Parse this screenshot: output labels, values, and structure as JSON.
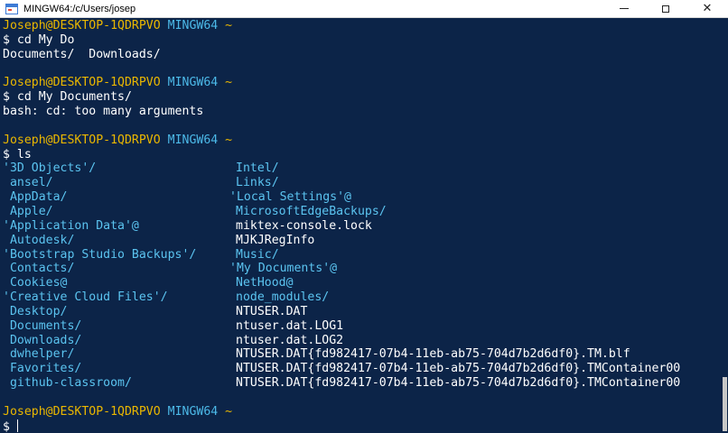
{
  "window": {
    "title": "MINGW64:/c/Users/josep",
    "close_glyph": "✕"
  },
  "prompt": {
    "user_host": "Joseph@DESKTOP-1QDRPVO",
    "system": "MINGW64",
    "path": "~",
    "symbol": "$"
  },
  "commands": [
    {
      "command": "cd My Do",
      "output": [
        "Documents/  Downloads/"
      ]
    },
    {
      "command": "cd My Documents/",
      "output": [
        "bash: cd: too many arguments"
      ]
    },
    {
      "command": "ls"
    }
  ],
  "ls_listing": {
    "rows": [
      {
        "left": "'3D Objects'/",
        "left_kind": "dir",
        "right": "Intel/",
        "right_kind": "dir"
      },
      {
        "left": " ansel/",
        "left_kind": "dir",
        "right": "Links/",
        "right_kind": "dir"
      },
      {
        "left": " AppData/",
        "left_kind": "dir",
        "right": "'Local Settings'@",
        "right_kind": "dir",
        "right_shift": true
      },
      {
        "left": " Apple/",
        "left_kind": "dir",
        "right": "MicrosoftEdgeBackups/",
        "right_kind": "dir"
      },
      {
        "left": "'Application Data'@",
        "left_kind": "dir",
        "right": "miktex-console.lock",
        "right_kind": "file"
      },
      {
        "left": " Autodesk/",
        "left_kind": "dir",
        "right": "MJKJRegInfo",
        "right_kind": "file"
      },
      {
        "left": "'Bootstrap Studio Backups'/",
        "left_kind": "dir",
        "right": "Music/",
        "right_kind": "dir"
      },
      {
        "left": " Contacts/",
        "left_kind": "dir",
        "right": "'My Documents'@",
        "right_kind": "dir",
        "right_shift": true
      },
      {
        "left": " Cookies@",
        "left_kind": "dir",
        "right": "NetHood@",
        "right_kind": "dir"
      },
      {
        "left": "'Creative Cloud Files'/",
        "left_kind": "dir",
        "right": "node_modules/",
        "right_kind": "dir"
      },
      {
        "left": " Desktop/",
        "left_kind": "dir",
        "right": "NTUSER.DAT",
        "right_kind": "file"
      },
      {
        "left": " Documents/",
        "left_kind": "dir",
        "right": "ntuser.dat.LOG1",
        "right_kind": "file"
      },
      {
        "left": " Downloads/",
        "left_kind": "dir",
        "right": "ntuser.dat.LOG2",
        "right_kind": "file"
      },
      {
        "left": " dwhelper/",
        "left_kind": "dir",
        "right": "NTUSER.DAT{fd982417-07b4-11eb-ab75-704d7b2d6df0}.TM.blf",
        "right_kind": "file"
      },
      {
        "left": " Favorites/",
        "left_kind": "dir",
        "right": "NTUSER.DAT{fd982417-07b4-11eb-ab75-704d7b2d6df0}.TMContainer00",
        "right_kind": "file"
      },
      {
        "left": " github-classroom/",
        "left_kind": "dir",
        "right": "NTUSER.DAT{fd982417-07b4-11eb-ab75-704d7b2d6df0}.TMContainer00",
        "right_kind": "file"
      }
    ]
  },
  "colors": {
    "background": "#0c2448",
    "user_host": "#eab700",
    "system": "#4cb9e8",
    "directory": "#5bc4f0",
    "text": "#ffffff"
  },
  "icons": {
    "app": "mingw-terminal-icon",
    "minimize": "minimize-icon",
    "maximize": "maximize-icon",
    "close": "close-icon"
  }
}
